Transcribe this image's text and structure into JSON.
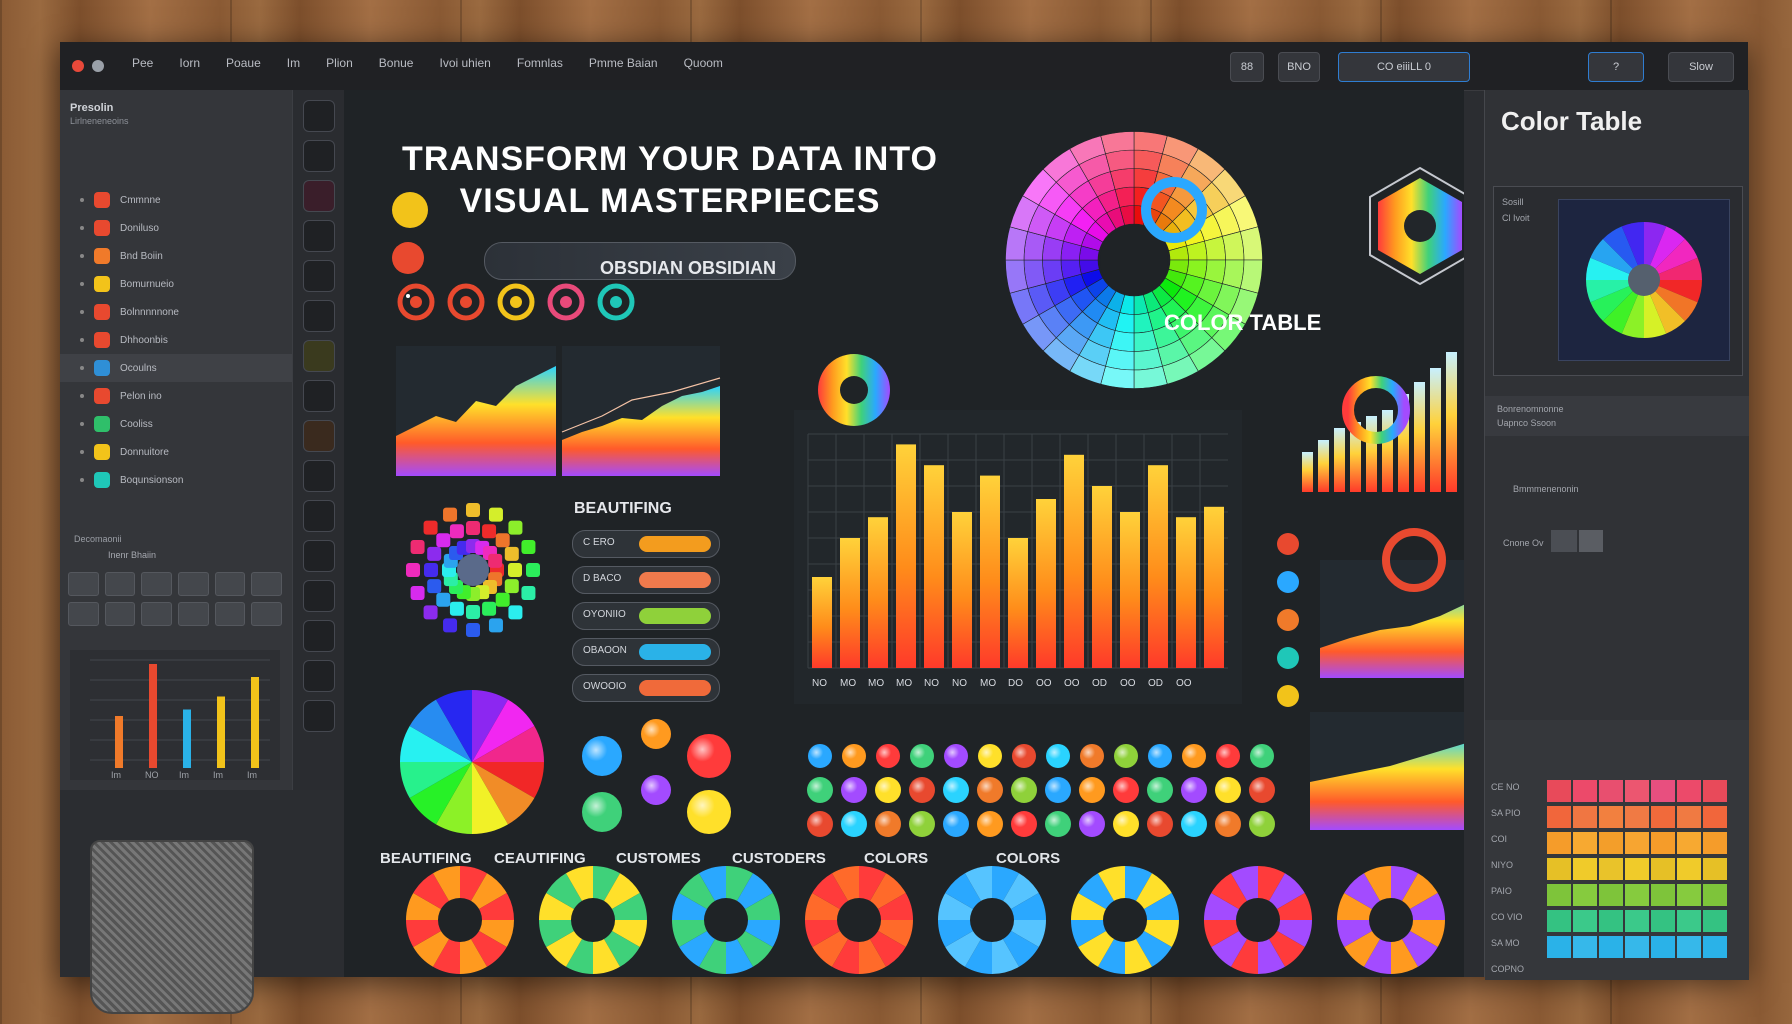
{
  "window": {
    "menu": [
      "Pee",
      "Iorn",
      "Poaue",
      "Im",
      "Plion",
      "Bonue",
      "Ivoi uhien",
      "Fomnlas",
      "Pmme Baian",
      "Quoom"
    ],
    "toolbar": {
      "btn_a": "88",
      "btn_b": "BNO",
      "btn_c": "CO eiiiLL  0",
      "icon_a": "?",
      "icon_b": "Slow"
    }
  },
  "left_panel": {
    "header": "Presolin",
    "sub": "Lirlneneneoins",
    "items": [
      {
        "label": "Cmmnne",
        "color": "#e8492f"
      },
      {
        "label": "Doniluso",
        "color": "#e8492f"
      },
      {
        "label": "Bnd Boiin",
        "color": "#f07a2a"
      },
      {
        "label": "Bomurnueio",
        "color": "#f2c31a"
      },
      {
        "label": "Bolnnnnnone",
        "color": "#e8492f"
      },
      {
        "label": "Dhhoonbis",
        "color": "#e8492f"
      },
      {
        "label": "Ocoulns",
        "color": "#2f8fd6"
      },
      {
        "label": "Pelon ino",
        "color": "#e8492f"
      },
      {
        "label": "Cooliss",
        "color": "#2fbf6a"
      },
      {
        "label": "Donnuitore",
        "color": "#f2c31a"
      },
      {
        "label": "Boqunsionson",
        "color": "#1fc7b8"
      }
    ],
    "footer": "Decomaonii",
    "grid_label": "Inenr Bhaiin",
    "mini_chart_ticks": [
      "Im",
      "NO",
      "Im",
      "Im",
      "Im"
    ],
    "mini_chart_values": [
      40,
      80,
      45,
      55,
      70
    ]
  },
  "canvas": {
    "heading_line1": "TRANSFORM YOUR DATA INTO",
    "heading_line2": "VISUAL MASTERPIECES",
    "subtitle": "OBSDIAN OBSIDIAN",
    "color_table_label": "COLOR TABLE",
    "beautifing": "BEAUTIFING",
    "pills": [
      {
        "label": "C ERO",
        "color": "#f39c1e"
      },
      {
        "label": "D BACO",
        "color": "#f07a4c"
      },
      {
        "label": "OYONIIO",
        "color": "#8fd13a"
      },
      {
        "label": "OBAOON",
        "color": "#2ab2e8"
      },
      {
        "label": "OWOOIO",
        "color": "#f06a3a"
      }
    ],
    "bar_ticks": [
      "NO",
      "MO",
      "MO",
      "MO",
      "NO",
      "NO",
      "MO",
      "DO",
      "OO",
      "OO",
      "OD",
      "OO",
      "OD",
      "OO"
    ],
    "bar_values": [
      35,
      50,
      58,
      86,
      78,
      60,
      74,
      50,
      65,
      82,
      70,
      60,
      78,
      58,
      62
    ],
    "bottom_labels": [
      "BEAUTIFING",
      "CEAUTIFING",
      "CUSTOMES",
      "CUSTODERS",
      "COLORS",
      "COLORS"
    ]
  },
  "right_panel": {
    "title": "Color Table",
    "desc_a": "Sosill",
    "desc_b": "Cl Ivoit",
    "section_title": "Bonrenomnonne",
    "section_sub": "Uapnco Ssoon",
    "small_a": "Bmmmenenonin",
    "small_b": "Cnone Ov",
    "table_rows": [
      "CE NO",
      "SA PIO",
      "COI",
      "NIYO",
      "PAIO",
      "CO VIO",
      "SA MO",
      "COPNO"
    ],
    "palette": [
      [
        "#e84a5a",
        "#ec4a6a",
        "#e84f6f",
        "#ec5670",
        "#e84f7f",
        "#ec4a6a",
        "#e84a5a"
      ],
      [
        "#f1663b",
        "#f07642",
        "#f2803f",
        "#f07a44",
        "#f16a3b",
        "#f07a42",
        "#f1663b"
      ],
      [
        "#f59c2a",
        "#f7a931",
        "#f39e2a",
        "#f7a531",
        "#f59c2a",
        "#f7a931",
        "#f59c2a"
      ],
      [
        "#e6c026",
        "#f0cb2a",
        "#e9c32a",
        "#f0cb2a",
        "#e6c026",
        "#f0cb2a",
        "#e6c026"
      ],
      [
        "#7ec43a",
        "#86cb3e",
        "#7ec43a",
        "#86cb3e",
        "#7ec43a",
        "#86cb3e",
        "#7ec43a"
      ],
      [
        "#34c282",
        "#3bc98a",
        "#34c282",
        "#3bc98a",
        "#34c282",
        "#3bc98a",
        "#34c282"
      ],
      [
        "#2ab2e8",
        "#36b8ea",
        "#2ab2e8",
        "#36b8ea",
        "#2ab2e8",
        "#36b8ea",
        "#2ab2e8"
      ]
    ]
  }
}
